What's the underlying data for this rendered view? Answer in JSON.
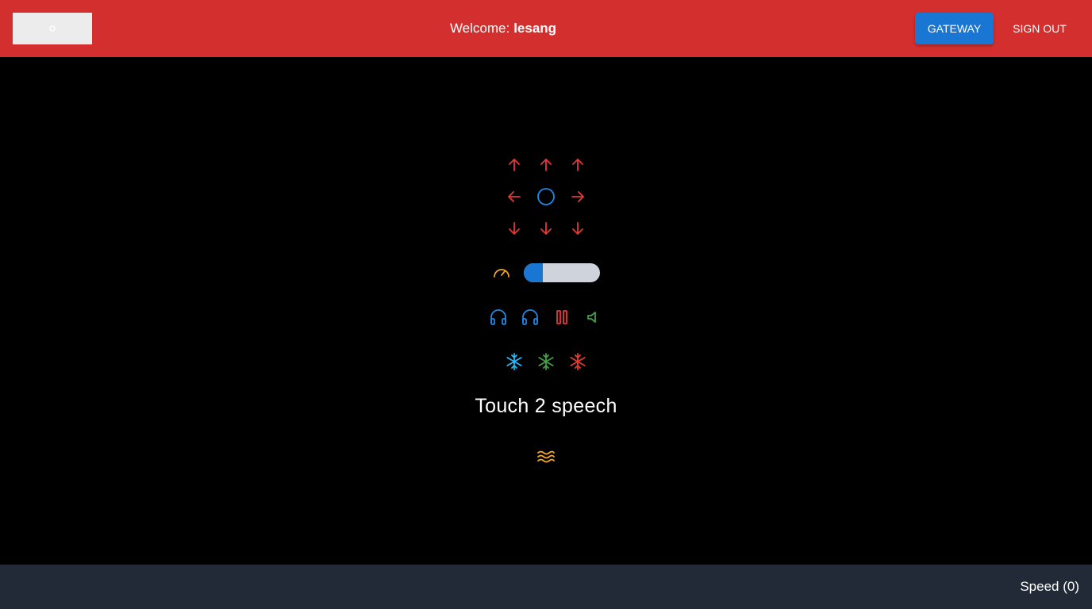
{
  "header": {
    "welcome_prefix": "Welcome:",
    "username": "lesang",
    "gateway_label": "GATEWAY",
    "signout_label": "SIGN OUT"
  },
  "controls": {
    "speed_slider_value": 0.25,
    "speech_title": "Touch 2 speech"
  },
  "footer": {
    "speed_label": "Speed (0)"
  },
  "colors": {
    "header_bg": "#d32f2f",
    "primary": "#1976d2",
    "red": "#e53935",
    "blue": "#1e88e5",
    "light_blue": "#29b6f6",
    "green": "#43a047",
    "orange": "#f5a623",
    "footer_bg": "#222a38"
  },
  "icons": [
    "arrow-up-left-icon",
    "arrow-up-icon",
    "arrow-up-right-icon",
    "arrow-left-icon",
    "stop-circle-icon",
    "arrow-right-icon",
    "arrow-down-left-icon",
    "arrow-down-icon",
    "arrow-down-right-icon",
    "speedometer-icon",
    "headphones-icon",
    "headphones-icon",
    "pause-icon",
    "volume-icon",
    "snowflake-icon",
    "snowflake-icon",
    "snowflake-icon",
    "waves-icon"
  ]
}
